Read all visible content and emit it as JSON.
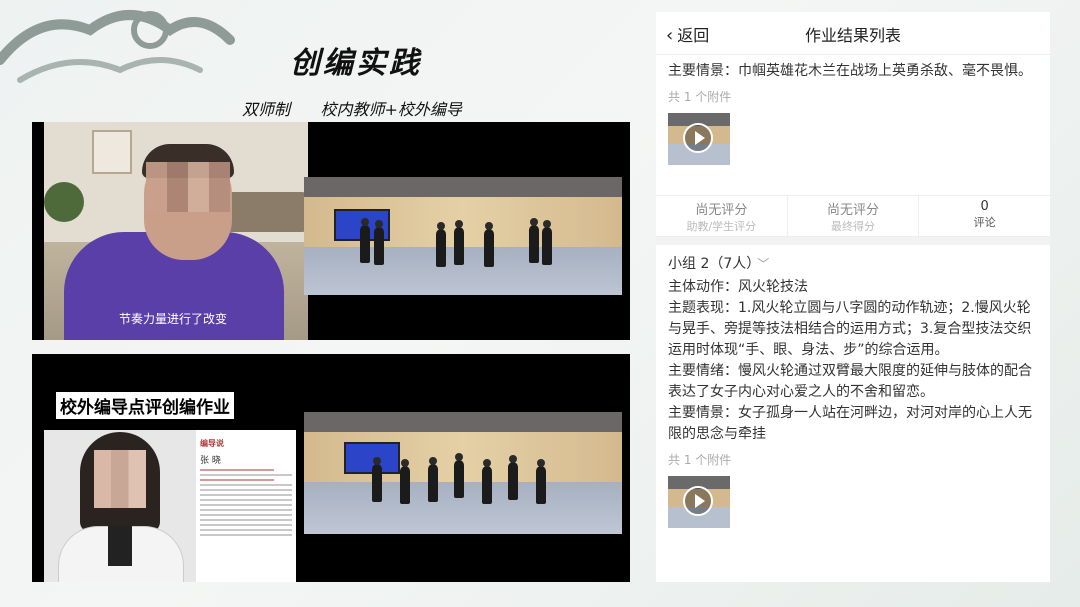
{
  "slide": {
    "title": "创编实践",
    "subtitle": "双师制      校内教师+校外编导"
  },
  "video1": {
    "caption": "节奏力量进行了改变"
  },
  "video2": {
    "label": "校外编导点评创编作业",
    "doc_heading": "编导说",
    "doc_name": "张 晓"
  },
  "panel": {
    "back_label": "返回",
    "title": "作业结果列表",
    "item1": {
      "text": "主要情景：巾帼英雄花木兰在战场上英勇杀敌、毫不畏惧。",
      "attachments": "共 1 个附件"
    },
    "scores": [
      {
        "value": "尚无评分",
        "label": "助教/学生评分"
      },
      {
        "value": "尚无评分",
        "label": "最终得分"
      },
      {
        "value": "0",
        "label": "评论"
      }
    ],
    "group2": {
      "name": "小组 2（7人）",
      "action": "主体动作：风火轮技法",
      "theme": "主题表现：1.风火轮立圆与八字圆的动作轨迹；2.慢风火轮与晃手、旁提等技法相结合的运用方式；3.复合型技法交织运用时体现“手、眼、身法、步”的综合运用。",
      "emotion": "主要情绪：慢风火轮通过双臂最大限度的延伸与肢体的配合表达了女子内心对心爱之人的不舍和留恋。",
      "scene": "主要情景：女子孤身一人站在河畔边，对河对岸的心上人无限的思念与牵挂",
      "attachments": "共 1 个附件"
    }
  }
}
